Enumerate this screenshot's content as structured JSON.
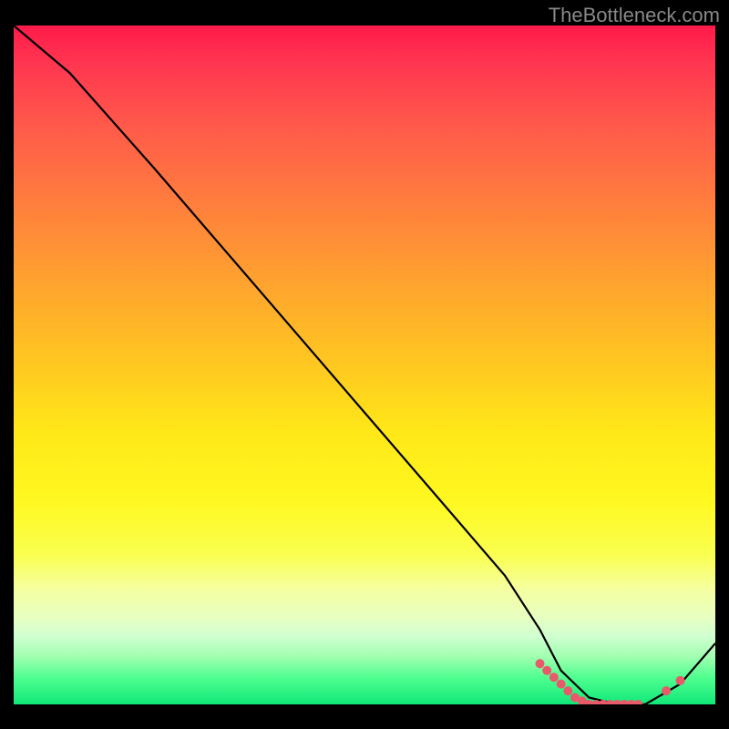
{
  "watermark": "TheBottleneck.com",
  "chart_data": {
    "type": "line",
    "title": "",
    "xlabel": "",
    "ylabel": "",
    "xlim": [
      0,
      100
    ],
    "ylim": [
      0,
      100
    ],
    "series": [
      {
        "name": "bottleneck-curve",
        "x": [
          0,
          8,
          20,
          30,
          40,
          50,
          60,
          70,
          75,
          78,
          82,
          86,
          90,
          95,
          100
        ],
        "y": [
          100,
          93,
          79,
          67,
          55,
          43,
          31,
          19,
          11,
          5,
          1,
          0,
          0,
          3,
          9
        ]
      }
    ],
    "markers": {
      "name": "highlight-points",
      "x": [
        75,
        76,
        77,
        78,
        79,
        80,
        81,
        82,
        83,
        84,
        85,
        86,
        87,
        88,
        89,
        93,
        95
      ],
      "y": [
        6,
        5,
        4,
        3,
        2,
        1,
        0.5,
        0,
        0,
        0,
        0,
        0,
        0,
        0,
        0,
        2,
        3.5
      ]
    }
  }
}
